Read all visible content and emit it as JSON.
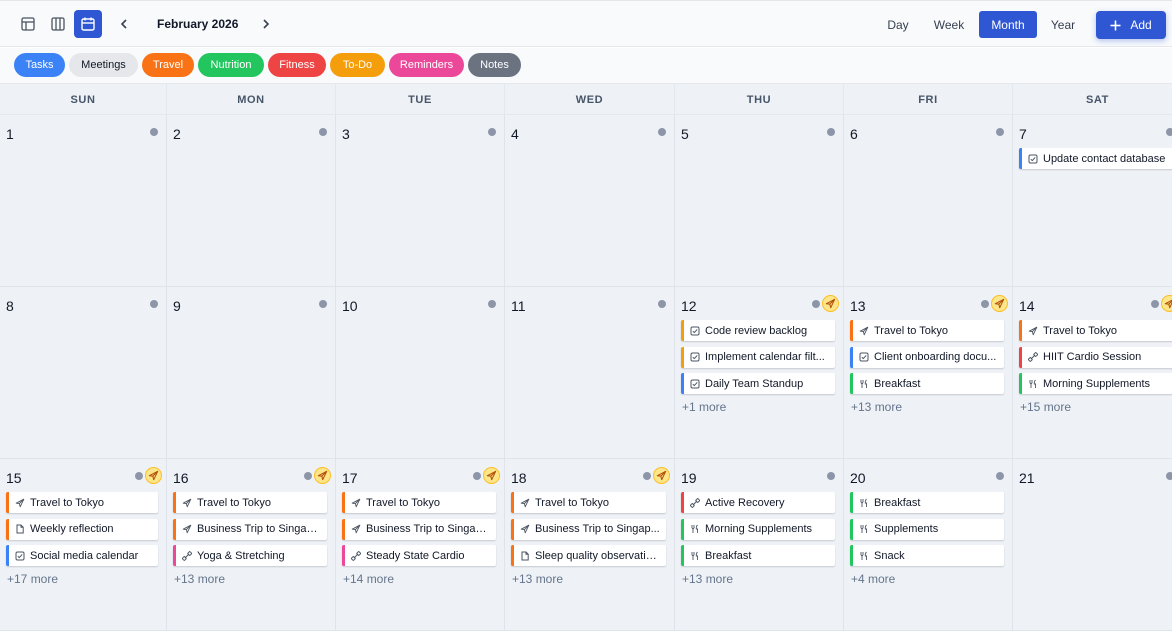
{
  "toolbar": {
    "month_title": "February 2026",
    "ranges": [
      "Day",
      "Week",
      "Month",
      "Year"
    ],
    "active_range": "Month",
    "add_label": "Add",
    "accent_color": "#2f56d3"
  },
  "filters": [
    {
      "label": "Tasks",
      "color": "#3b82f6",
      "text_color": "#ffffff"
    },
    {
      "label": "Meetings",
      "color": "#e5e7eb",
      "text_color": "#111827"
    },
    {
      "label": "Travel",
      "color": "#f97316",
      "text_color": "#ffffff"
    },
    {
      "label": "Nutrition",
      "color": "#22c55e",
      "text_color": "#ffffff"
    },
    {
      "label": "Fitness",
      "color": "#ef4444",
      "text_color": "#ffffff"
    },
    {
      "label": "To-Do",
      "color": "#f59e0b",
      "text_color": "#ffffff"
    },
    {
      "label": "Reminders",
      "color": "#ec4899",
      "text_color": "#ffffff"
    },
    {
      "label": "Notes",
      "color": "#6b7280",
      "text_color": "#ffffff"
    }
  ],
  "weekdays": [
    "SUN",
    "MON",
    "TUE",
    "WED",
    "THU",
    "FRI",
    "SAT"
  ],
  "weeks": [
    [
      {
        "day": "1",
        "badge": false,
        "events": [],
        "more": ""
      },
      {
        "day": "2",
        "badge": false,
        "events": [],
        "more": ""
      },
      {
        "day": "3",
        "badge": false,
        "events": [],
        "more": ""
      },
      {
        "day": "4",
        "badge": false,
        "events": [],
        "more": ""
      },
      {
        "day": "5",
        "badge": false,
        "events": [],
        "more": ""
      },
      {
        "day": "6",
        "badge": false,
        "events": [],
        "more": ""
      },
      {
        "day": "7",
        "badge": false,
        "events": [
          {
            "label": "Update contact database",
            "icon": "checkbox-icon",
            "color": "#3b82f6"
          }
        ],
        "more": ""
      }
    ],
    [
      {
        "day": "8",
        "badge": false,
        "events": [],
        "more": ""
      },
      {
        "day": "9",
        "badge": false,
        "events": [],
        "more": ""
      },
      {
        "day": "10",
        "badge": false,
        "events": [],
        "more": ""
      },
      {
        "day": "11",
        "badge": false,
        "events": [],
        "more": ""
      },
      {
        "day": "12",
        "badge": true,
        "events": [
          {
            "label": "Code review backlog",
            "icon": "checkbox-icon",
            "color": "#f59e0b"
          },
          {
            "label": "Implement calendar filt...",
            "icon": "checkbox-icon",
            "color": "#f59e0b"
          },
          {
            "label": "Daily Team Standup",
            "icon": "checkbox-icon",
            "color": "#3b82f6"
          }
        ],
        "more": "+1 more"
      },
      {
        "day": "13",
        "badge": true,
        "events": [
          {
            "label": "Travel to Tokyo",
            "icon": "plane-icon",
            "color": "#f97316"
          },
          {
            "label": "Client onboarding docu...",
            "icon": "checkbox-icon",
            "color": "#3b82f6"
          },
          {
            "label": "Breakfast",
            "icon": "utensils-icon",
            "color": "#22c55e"
          }
        ],
        "more": "+13 more"
      },
      {
        "day": "14",
        "badge": true,
        "events": [
          {
            "label": "Travel to Tokyo",
            "icon": "plane-icon",
            "color": "#f97316"
          },
          {
            "label": "HIIT Cardio Session",
            "icon": "dumbbell-icon",
            "color": "#ef4444"
          },
          {
            "label": "Morning Supplements",
            "icon": "utensils-icon",
            "color": "#22c55e"
          }
        ],
        "more": "+15 more"
      }
    ],
    [
      {
        "day": "15",
        "badge": true,
        "events": [
          {
            "label": "Travel to Tokyo",
            "icon": "plane-icon",
            "color": "#f97316"
          },
          {
            "label": "Weekly reflection",
            "icon": "note-icon",
            "color": "#f97316"
          },
          {
            "label": "Social media calendar",
            "icon": "checkbox-icon",
            "color": "#3b82f6"
          }
        ],
        "more": "+17 more"
      },
      {
        "day": "16",
        "badge": true,
        "events": [
          {
            "label": "Travel to Tokyo",
            "icon": "plane-icon",
            "color": "#f97316"
          },
          {
            "label": "Business Trip to Singap...",
            "icon": "plane-icon",
            "color": "#f97316"
          },
          {
            "label": "Yoga & Stretching",
            "icon": "dumbbell-icon",
            "color": "#ec4899"
          }
        ],
        "more": "+13 more"
      },
      {
        "day": "17",
        "badge": true,
        "events": [
          {
            "label": "Travel to Tokyo",
            "icon": "plane-icon",
            "color": "#f97316"
          },
          {
            "label": "Business Trip to Singap...",
            "icon": "plane-icon",
            "color": "#f97316"
          },
          {
            "label": "Steady State Cardio",
            "icon": "dumbbell-icon",
            "color": "#ec4899"
          }
        ],
        "more": "+14 more"
      },
      {
        "day": "18",
        "badge": true,
        "events": [
          {
            "label": "Travel to Tokyo",
            "icon": "plane-icon",
            "color": "#f97316"
          },
          {
            "label": "Business Trip to Singap...",
            "icon": "plane-icon",
            "color": "#f97316"
          },
          {
            "label": "Sleep quality observatio...",
            "icon": "note-icon",
            "color": "#f97316"
          }
        ],
        "more": "+13 more"
      },
      {
        "day": "19",
        "badge": false,
        "events": [
          {
            "label": "Active Recovery",
            "icon": "dumbbell-icon",
            "color": "#ef4444"
          },
          {
            "label": "Morning Supplements",
            "icon": "utensils-icon",
            "color": "#22c55e"
          },
          {
            "label": "Breakfast",
            "icon": "utensils-icon",
            "color": "#22c55e"
          }
        ],
        "more": "+13 more"
      },
      {
        "day": "20",
        "badge": false,
        "events": [
          {
            "label": "Breakfast",
            "icon": "utensils-icon",
            "color": "#22c55e"
          },
          {
            "label": "Supplements",
            "icon": "utensils-icon",
            "color": "#22c55e"
          },
          {
            "label": "Snack",
            "icon": "utensils-icon",
            "color": "#22c55e"
          }
        ],
        "more": "+4 more"
      },
      {
        "day": "21",
        "badge": false,
        "events": [],
        "more": ""
      }
    ]
  ]
}
